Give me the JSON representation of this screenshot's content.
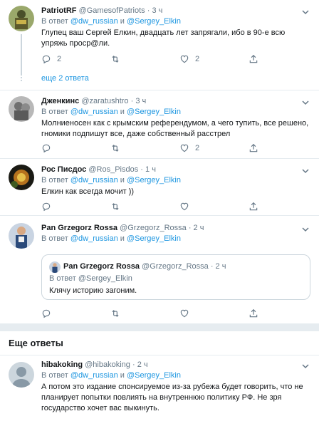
{
  "tweets": [
    {
      "name": "PatriotRF",
      "handle": "@GamesofPatriots",
      "time": "3 ч",
      "reply_prefix": "В ответ",
      "mention1": "@dw_russian",
      "conj": "и",
      "mention2": "@Sergey_Elkin",
      "text": "Глупец ваш Сергей Елкин, двадцать лет запрягали, ибо в 90-е всю упряжь проср@ли.",
      "reply_count": "2",
      "like_count": "2"
    },
    {
      "name": "Дженкинс",
      "handle": "@zaratushtro",
      "time": "3 ч",
      "reply_prefix": "В ответ",
      "mention1": "@dw_russian",
      "conj": "и",
      "mention2": "@Sergey_Elkin",
      "text": "Молниеносен как с крымским референдумом, а чего тупить, все решено, гномики подпишут все, даже собственный расстрел",
      "reply_count": "",
      "like_count": "2"
    },
    {
      "name": "Рос Писдос",
      "handle": "@Ros_Pisdos",
      "time": "1 ч",
      "reply_prefix": "В ответ",
      "mention1": "@dw_russian",
      "conj": "и",
      "mention2": "@Sergey_Elkin",
      "text": "Елкин как всегда мочит ))",
      "reply_count": "",
      "like_count": ""
    },
    {
      "name": "Pan Grzegorz Rossa",
      "handle": "@Grzegorz_Rossa",
      "time": "2 ч",
      "reply_prefix": "В ответ",
      "mention1": "@dw_russian",
      "conj": "и",
      "mention2": "@Sergey_Elkin",
      "text": "",
      "reply_count": "",
      "like_count": ""
    },
    {
      "name": "hibakoking",
      "handle": "@hibakoking",
      "time": "2 ч",
      "reply_prefix": "В ответ",
      "mention1": "@dw_russian",
      "conj": "и",
      "mention2": "@Sergey_Elkin",
      "text": "А потом это издание спонсируемое из-за рубежа будет говорить, что не планирует попытки повлиять на внутреннюю политику РФ. Не зря государство хочет вас выкинуть."
    }
  ],
  "show_more_replies": "еще 2 ответа",
  "quote": {
    "name": "Pan Grzegorz Rossa",
    "handle": "@Grzegorz_Rossa",
    "time": "2 ч",
    "reply_prefix": "В ответ",
    "mention": "@Sergey_Elkin",
    "text": "Клячу историю загоним."
  },
  "section_header": "Еще ответы",
  "icons": [
    "reply-icon",
    "retweet-icon",
    "like-icon",
    "share-icon",
    "caret-down-icon"
  ],
  "colors": {
    "link": "#1b95e0",
    "secondary": "#657786",
    "border": "#e6ecf0"
  }
}
